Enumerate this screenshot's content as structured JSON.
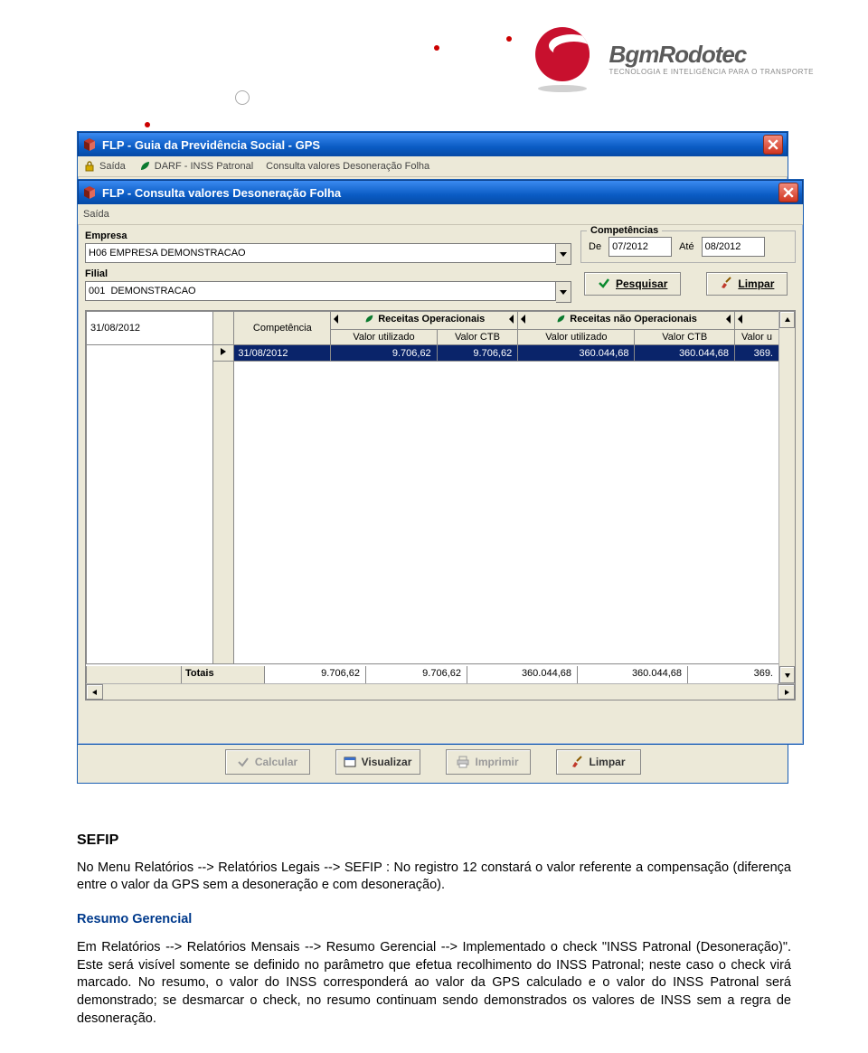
{
  "logo": {
    "brand": "BgmRodotec",
    "tagline": "TECNOLOGIA E INTELIGÊNCIA PARA O TRANSPORTE"
  },
  "win1": {
    "title": "FLP  -  Guia da Previdência Social  -  GPS",
    "menu": {
      "saida": "Saída",
      "darf": "DARF - INSS Patronal",
      "consulta": "Consulta valores Desoneração Folha"
    },
    "buttons": {
      "calcular": "Calcular",
      "visualizar": "Visualizar",
      "imprimir": "Imprimir",
      "limpar": "Limpar"
    }
  },
  "win2": {
    "title": "FLP  -  Consulta valores Desoneração Folha",
    "menu": {
      "saida": "Saída"
    },
    "labels": {
      "empresa": "Empresa",
      "filial": "Filial",
      "competencias": "Competências",
      "de": "De",
      "ate": "Até"
    },
    "values": {
      "empresa": "H06 EMPRESA DEMONSTRACAO",
      "filial": "001  DEMONSTRACAO",
      "de": "07/2012",
      "ate": "08/2012"
    },
    "buttons": {
      "pesquisar": "Pesquisar",
      "limpar": "Limpar"
    },
    "grid": {
      "left_date": "31/08/2012",
      "groups": {
        "g1": "Receitas Operacionais",
        "g2": "Receitas não Operacionais"
      },
      "cols": {
        "competencia": "Competência",
        "valor_utilizado": "Valor utilizado",
        "valor_ctb": "Valor CTB",
        "valor_utilizado2": "Valor utilizado",
        "valor_ctb2": "Valor CTB",
        "valor_u": "Valor u"
      },
      "row": {
        "competencia": "31/08/2012",
        "v1": "9.706,62",
        "v2": "9.706,62",
        "v3": "360.044,68",
        "v4": "360.044,68",
        "v5": "369."
      },
      "totals": {
        "label": "Totais",
        "t1": "9.706,62",
        "t2": "9.706,62",
        "t3": "360.044,68",
        "t4": "360.044,68",
        "t5": "369."
      }
    }
  },
  "doc": {
    "h_sefip": "SEFIP",
    "p1": "No Menu Relatórios --> Relatórios Legais --> SEFIP : No registro 12 constará o valor referente a compensação (diferença entre o valor da GPS sem a desoneração e com desoneração).",
    "h_resumo": "Resumo Gerencial",
    "p2": "Em Relatórios --> Relatórios Mensais --> Resumo Gerencial --> Implementado o check \"INSS Patronal (Desoneração)\". Este será visível somente se definido no parâmetro que efetua recolhimento do INSS Patronal; neste caso o check virá marcado.  No resumo, o valor do INSS corresponderá ao valor da GPS calculado e o valor do INSS Patronal será demonstrado;  se desmarcar o check, no resumo continuam sendo demonstrados os valores de INSS sem a regra de desoneração."
  }
}
